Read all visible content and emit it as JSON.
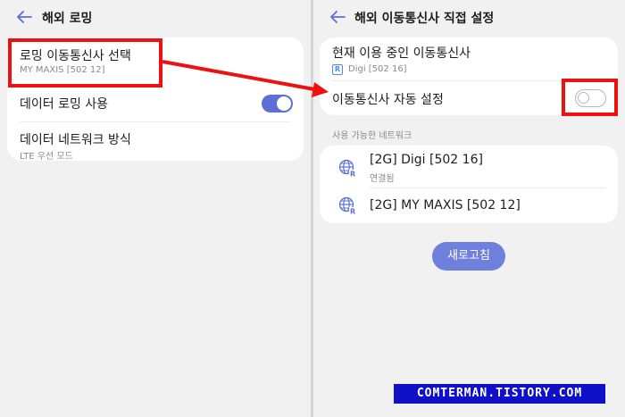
{
  "left": {
    "title": "해외 로밍",
    "items": [
      {
        "label": "로밍 이동통신사 선택",
        "sub": "MY MAXIS [502 12]"
      },
      {
        "label": "데이터 로밍 사용",
        "toggle": "on"
      },
      {
        "label": "데이터 네트워크 방식",
        "sub": "LTE 우선 모드"
      }
    ]
  },
  "right": {
    "title": "해외 이동통신사 직접 설정",
    "current_label": "현재 이용 중인 이동통신사",
    "current_badge": "R",
    "current_value": "Digi [502 16]",
    "auto_label": "이동통신사 자동 설정",
    "auto_toggle": "off",
    "section_label": "사용 가능한 네트워크",
    "networks": [
      {
        "name": "[2G] Digi [502 16]",
        "status": "연결됨"
      },
      {
        "name": "[2G] MY MAXIS [502 12]"
      }
    ],
    "refresh_label": "새로고침"
  },
  "watermark": "COMTERMAN.TISTORY.COM",
  "colors": {
    "accent": "#5b6fd6",
    "highlight": "#ee1111",
    "watermark_bg": "#1010c8"
  }
}
